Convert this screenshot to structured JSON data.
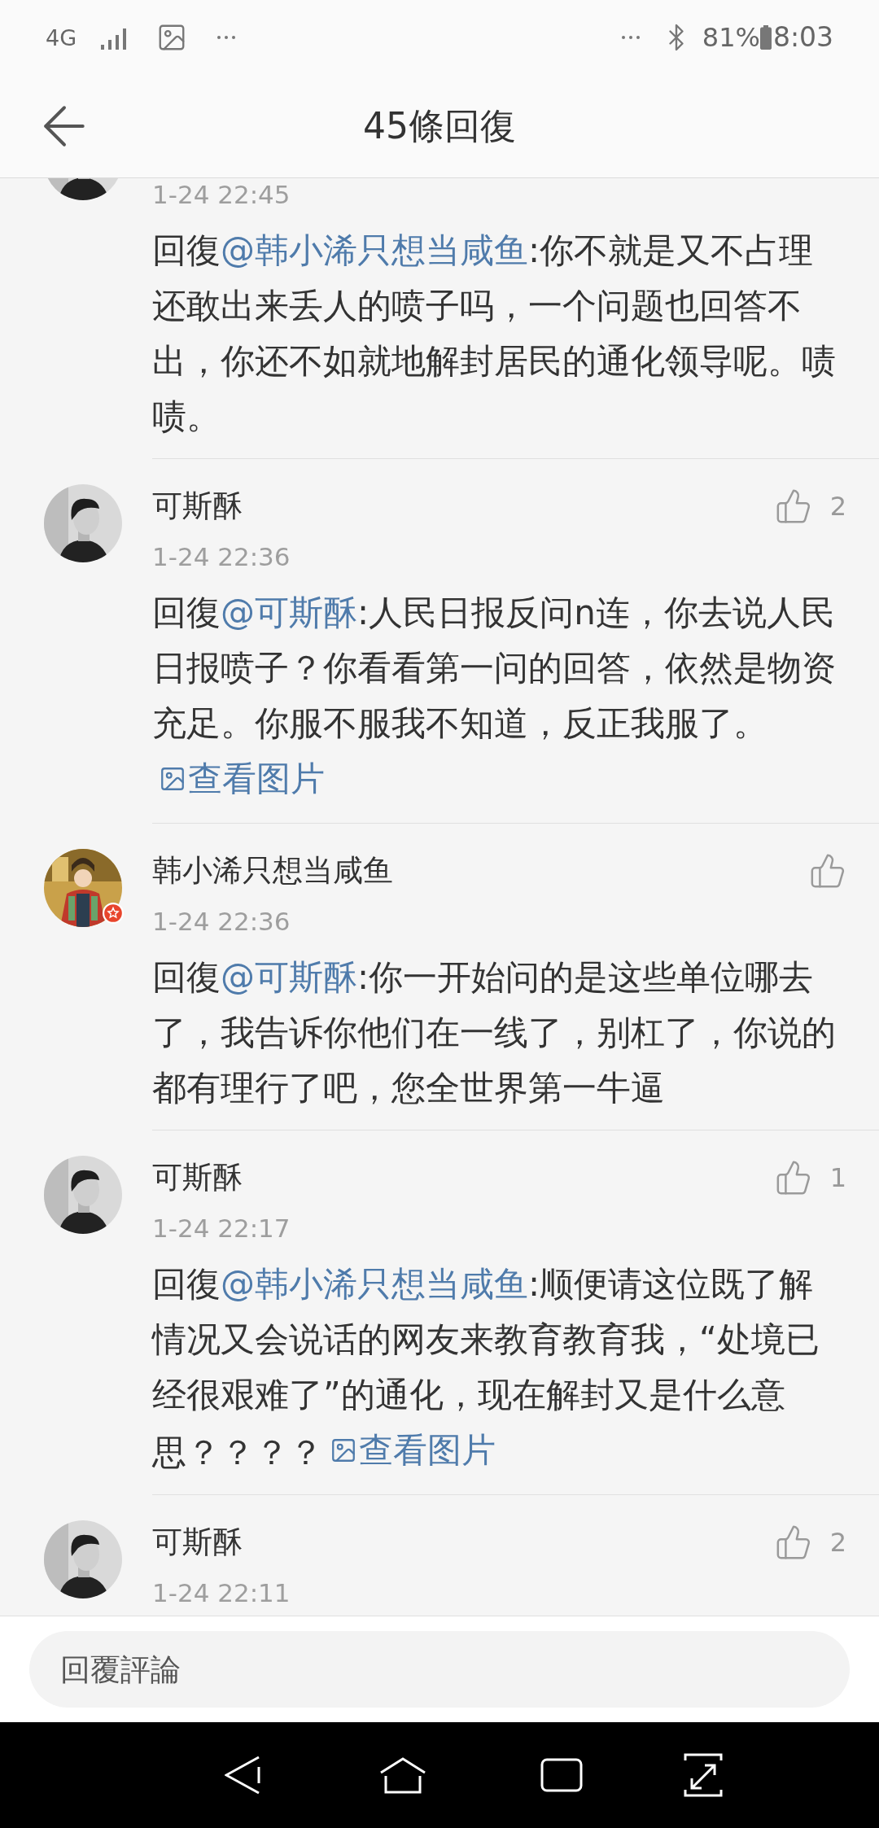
{
  "status_bar": {
    "network": "4G",
    "battery": "81%",
    "time": "8:03"
  },
  "header": {
    "title": "45條回復"
  },
  "comments": [
    {
      "verified": false,
      "time": "1-24 22:45",
      "body": {
        "prefix": "回復",
        "mention": "@韩小浠只想当咸鱼",
        "text": ":你不就是又不占理还敢出来丢人的喷子吗，一个问题也回答不出，你还不如就地解封居民的通化领导呢。啧啧。"
      }
    },
    {
      "author": "可斯酥",
      "verified": false,
      "time": "1-24 22:36",
      "likes": "2",
      "body": {
        "prefix": "回復",
        "mention": "@可斯酥",
        "text": ":人民日报反问n连，你去说人民日报喷子？你看看第一问的回答，依然是物资充足。你服不服我不知道，反正我服了。",
        "image_link": "查看图片"
      }
    },
    {
      "author": "韩小浠只想当咸鱼",
      "verified": true,
      "time": "1-24 22:36",
      "body": {
        "prefix": "回復",
        "mention": "@可斯酥",
        "text": ":你一开始问的是这些单位哪去了，我告诉你他们在一线了，别杠了，你说的都有理行了吧，您全世界第一牛逼"
      }
    },
    {
      "author": "可斯酥",
      "verified": false,
      "time": "1-24 22:17",
      "likes": "1",
      "body": {
        "prefix": "回復",
        "mention": "@韩小浠只想当咸鱼",
        "text": ":顺便请这位既了解情况又会说话的网友来教育教育我，“处境已经很艰难了”的通化，现在解封又是什么意思？？？？",
        "image_link": "查看图片"
      }
    },
    {
      "author": "可斯酥",
      "verified": false,
      "time": "1-24 22:11",
      "likes": "2"
    }
  ],
  "reply_bar": {
    "placeholder": "回覆評論"
  }
}
